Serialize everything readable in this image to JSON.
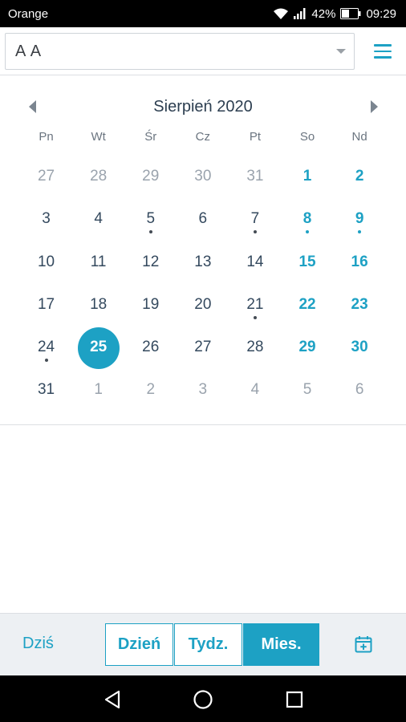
{
  "status_bar": {
    "carrier": "Orange",
    "battery": "42%",
    "time": "09:29",
    "icons": [
      "wifi-icon",
      "signal-icon",
      "battery-icon"
    ]
  },
  "app_bar": {
    "select_value": "A A",
    "menu_icon": "hamburger-menu-icon"
  },
  "calendar": {
    "month_title": "Sierpień 2020",
    "weekdays": [
      "Pn",
      "Wt",
      "Śr",
      "Cz",
      "Pt",
      "So",
      "Nd"
    ],
    "weeks": [
      [
        "27",
        "28",
        "29",
        "30",
        "31",
        "1",
        "2"
      ],
      [
        "3",
        "4",
        "5",
        "6",
        "7",
        "8",
        "9"
      ],
      [
        "10",
        "11",
        "12",
        "13",
        "14",
        "15",
        "16"
      ],
      [
        "17",
        "18",
        "19",
        "20",
        "21",
        "22",
        "23"
      ],
      [
        "24",
        "25",
        "26",
        "27",
        "28",
        "29",
        "30"
      ],
      [
        "31",
        "1",
        "2",
        "3",
        "4",
        "5",
        "6"
      ]
    ],
    "selected_day": "25",
    "days_with_events": [
      "5",
      "7",
      "8",
      "9",
      "21",
      "24"
    ],
    "accent_color": "#1da1c4"
  },
  "toolbar": {
    "today_label": "Dziś",
    "view_day_label": "Dzień",
    "view_week_label": "Tydz.",
    "view_month_label": "Mies.",
    "active_view": "Mies.",
    "add_event_icon": "calendar-add-icon"
  },
  "nav_bar": {
    "icons": [
      "back-icon",
      "home-icon",
      "recents-icon"
    ]
  }
}
